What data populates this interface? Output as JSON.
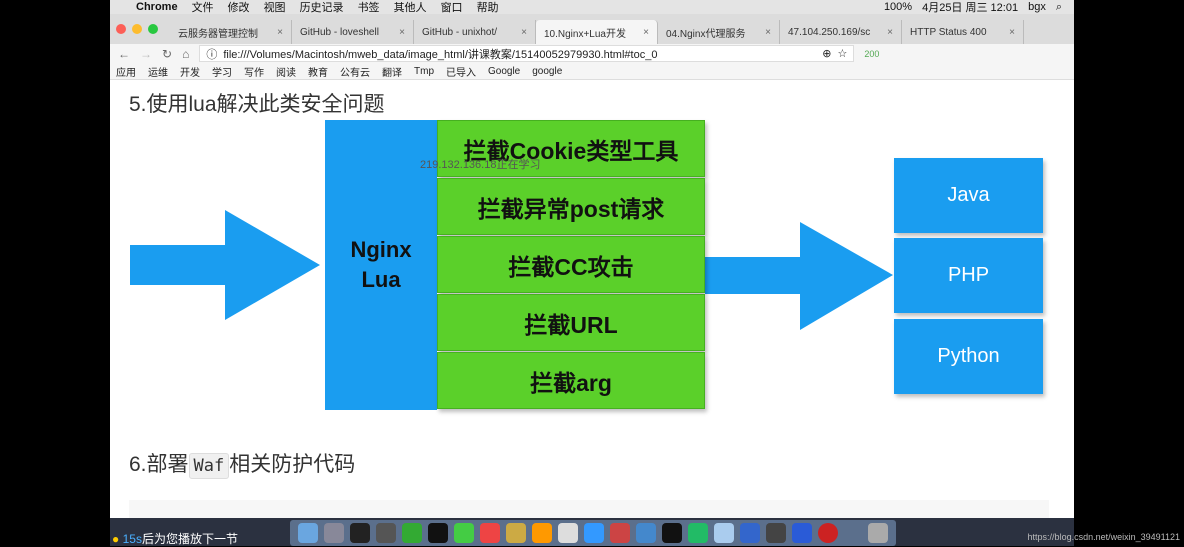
{
  "menubar": {
    "app": "Chrome",
    "items": [
      "文件",
      "修改",
      "视图",
      "历史记录",
      "书签",
      "其他人",
      "窗口",
      "帮助"
    ],
    "status": [
      "100%",
      "4月25日 周三 12:01",
      "bgx"
    ]
  },
  "tabs": [
    {
      "label": "云服务器管理控制"
    },
    {
      "label": "GitHub - loveshell"
    },
    {
      "label": "GitHub - unixhot/"
    },
    {
      "label": "10.Nginx+Lua开发",
      "active": true
    },
    {
      "label": "04.Nginx代理服务"
    },
    {
      "label": "47.104.250.169/sc"
    },
    {
      "label": "HTTP Status 400"
    }
  ],
  "address": {
    "url": "file:///Volumes/Macintosh/mweb_data/image_html/讲课教案/15140052979930.html#toc_0",
    "ext_count": "200"
  },
  "bookmarks": [
    "应用",
    "运维",
    "开发",
    "学习",
    "写作",
    "阅读",
    "教育",
    "公有云",
    "翻译",
    "Tmp",
    "已导入",
    "Google",
    "google"
  ],
  "page": {
    "heading5": "5.使用lua解决此类安全问题",
    "diagram": {
      "center": [
        "Nginx",
        "Lua"
      ],
      "rules": [
        "拦截Cookie类型工具",
        "拦截异常post请求",
        "拦截CC攻击",
        "拦截URL",
        "拦截arg"
      ],
      "backends": [
        "Java",
        "PHP",
        "Python"
      ],
      "arrow_color": "#1a9df0",
      "rule_color": "#5bd02a"
    },
    "watermark": "219.132.136.18正在学习",
    "heading6_pre": "6.部署",
    "heading6_code": "Waf",
    "heading6_post": "相关防护代码"
  },
  "footer": {
    "countdown": "15s",
    "notice": "后为您播放下一节",
    "credit": "https://blog.csdn.net/weixin_39491121"
  }
}
